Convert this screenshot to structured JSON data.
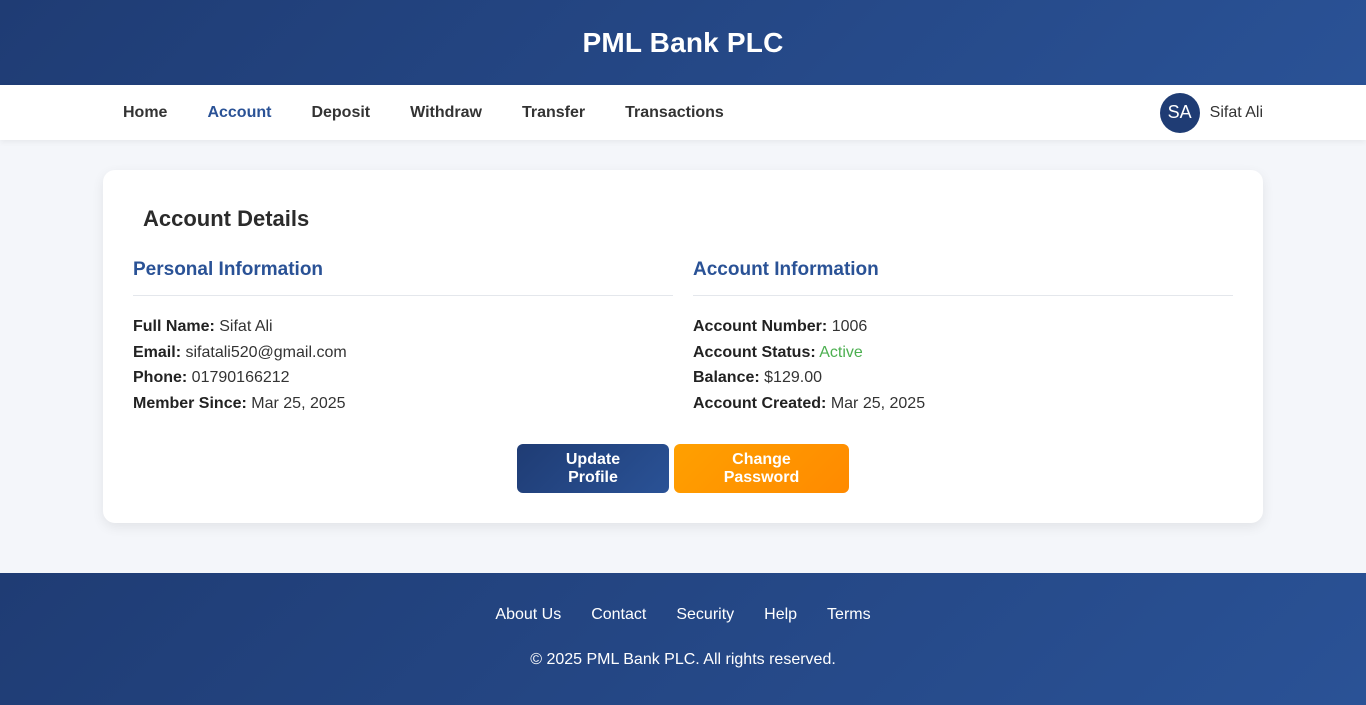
{
  "header": {
    "title": "PML Bank PLC"
  },
  "nav": {
    "items": [
      {
        "label": "Home",
        "active": false
      },
      {
        "label": "Account",
        "active": true
      },
      {
        "label": "Deposit",
        "active": false
      },
      {
        "label": "Withdraw",
        "active": false
      },
      {
        "label": "Transfer",
        "active": false
      },
      {
        "label": "Transactions",
        "active": false
      }
    ],
    "user": {
      "initials": "SA",
      "name": "Sifat Ali"
    }
  },
  "card": {
    "title": "Account Details",
    "personal": {
      "heading": "Personal Information",
      "full_name_label": "Full Name:",
      "full_name": "Sifat Ali",
      "email_label": "Email:",
      "email": "sifatali520@gmail.com",
      "phone_label": "Phone:",
      "phone": "01790166212",
      "member_since_label": "Member Since:",
      "member_since": "Mar 25, 2025"
    },
    "account": {
      "heading": "Account Information",
      "number_label": "Account Number:",
      "number": "1006",
      "status_label": "Account Status:",
      "status": "Active",
      "balance_label": "Balance:",
      "balance": "$129.00",
      "created_label": "Account Created:",
      "created": "Mar 25, 2025"
    },
    "buttons": {
      "update_profile": "Update Profile",
      "change_password": "Change Password"
    }
  },
  "footer": {
    "links": [
      "About Us",
      "Contact",
      "Security",
      "Help",
      "Terms"
    ],
    "copyright": "© 2025 PML Bank PLC. All rights reserved."
  },
  "colors": {
    "primary": "#1f3c74",
    "accent": "#2a5296",
    "warning": "#ff9800",
    "success": "#4caf50"
  }
}
